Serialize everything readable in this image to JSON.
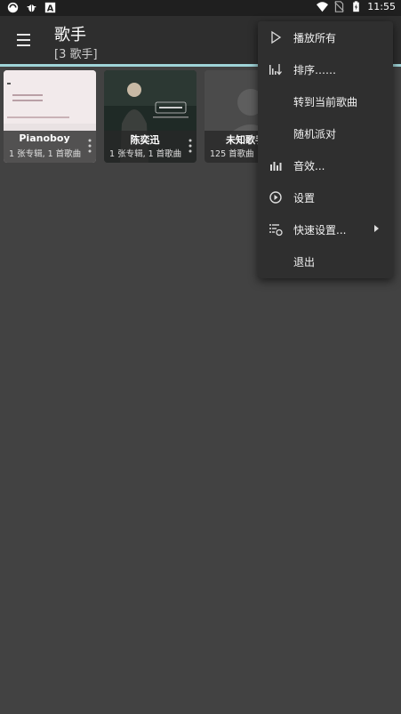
{
  "status_bar": {
    "time": "11:55",
    "left_icons": [
      "app-notification-icon",
      "debug-bug-icon",
      "text-a-icon"
    ],
    "right_icons": [
      "wifi-icon",
      "no-sim-icon",
      "battery-charging-icon"
    ]
  },
  "app_bar": {
    "menu_icon": "hamburger-menu-icon",
    "title": "歌手",
    "subtitle": "[3 歌手]",
    "accent_color": "#9fd4d8"
  },
  "artists": [
    {
      "name": "Pianoboy",
      "info": "1 张专辑, 1 首歌曲"
    },
    {
      "name": "陈奕迅",
      "info": "1 张专辑, 1 首歌曲"
    },
    {
      "name": "未知歌手",
      "info": "125 首歌曲"
    }
  ],
  "overflow_menu": {
    "items": [
      {
        "label": "播放所有",
        "icon": "play-outline-icon"
      },
      {
        "label": "排序……",
        "icon": "sort-icon"
      },
      {
        "label": "转到当前歌曲",
        "icon": ""
      },
      {
        "label": "随机派对",
        "icon": ""
      },
      {
        "label": "音效...",
        "icon": "equalizer-icon"
      },
      {
        "label": "设置",
        "icon": "settings-icon"
      },
      {
        "label": "快速设置...",
        "icon": "quick-settings-icon",
        "has_submenu": true
      },
      {
        "label": "退出",
        "icon": ""
      }
    ]
  }
}
